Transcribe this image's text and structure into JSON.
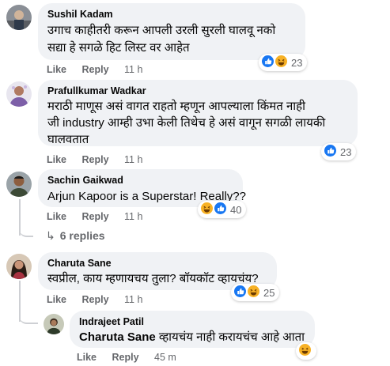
{
  "comments": [
    {
      "author": "Sushil Kadam",
      "lines": [
        "उगाच काहीतरी करून आपली उरली सुरली घालवू नको",
        "सद्या हे सगळे हिट लिस्ट वर आहेत"
      ],
      "like": "Like",
      "reply": "Reply",
      "time": "11 h",
      "reactions": [
        "like",
        "haha"
      ],
      "count": "23"
    },
    {
      "author": "Prafullkumar Wadkar",
      "lines": [
        "मराठी माणूस असं वागत राहतो म्हणून आपल्याला किंमत नाही",
        "जी industry आम्ही उभा केली तिथेच हे असं वागून सगळी लायकी",
        "घालवतात"
      ],
      "like": "Like",
      "reply": "Reply",
      "time": "11 h",
      "reactions": [
        "like"
      ],
      "count": "23"
    },
    {
      "author": "Sachin Gaikwad",
      "lines": [
        "Arjun Kapoor is a Superstar! Really??"
      ],
      "like": "Like",
      "reply": "Reply",
      "time": "11 h",
      "reactions": [
        "haha",
        "like"
      ],
      "count": "40",
      "replies_label": "6 replies"
    },
    {
      "author": "Charuta Sane",
      "lines": [
        "स्वप्रील, काय म्हणायचय तुला? बॉयकॉट व्हायचंय?"
      ],
      "like": "Like",
      "reply": "Reply",
      "time": "11 h",
      "reactions": [
        "like",
        "haha"
      ],
      "count": "25"
    }
  ],
  "reply": {
    "author": "Indrajeet Patil",
    "mention": "Charuta Sane",
    "text": " व्हायचंय नाही करायचंच आहे आता",
    "like": "Like",
    "reply": "Reply",
    "time": "45 m",
    "reactions": [
      "haha"
    ]
  },
  "colors": {
    "like_blue": "#1877f2",
    "haha_yellow": "#f7b125",
    "meta_gray": "#65676b",
    "bubble_gray": "#f0f2f5"
  }
}
